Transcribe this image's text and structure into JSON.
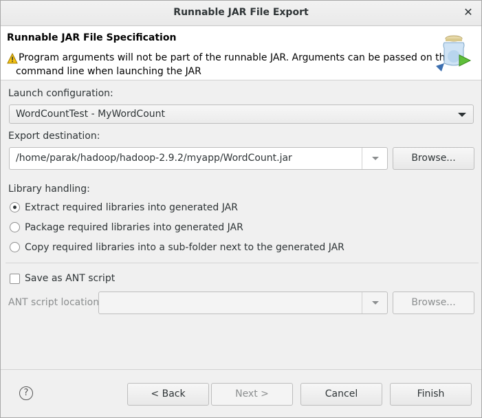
{
  "window": {
    "title": "Runnable JAR File Export",
    "close_glyph": "✕"
  },
  "header": {
    "title": "Runnable JAR File Specification",
    "warning_icon": "warning-triangle-icon",
    "message_line1": "Program arguments will not be part of the runnable JAR. Arguments can be passed on the",
    "message_line2": "command line when launching the JAR",
    "banner_icon": "jar-export-icon"
  },
  "launch": {
    "label": "Launch configuration:",
    "value": "WordCountTest - MyWordCount"
  },
  "export": {
    "label": "Export destination:",
    "value": "/home/parak/hadoop/hadoop-2.9.2/myapp/WordCount.jar",
    "browse_label": "Browse..."
  },
  "library": {
    "label": "Library handling:",
    "options": [
      {
        "label": "Extract required libraries into generated JAR",
        "selected": true
      },
      {
        "label": "Package required libraries into generated JAR",
        "selected": false
      },
      {
        "label": "Copy required libraries into a sub-folder next to the generated JAR",
        "selected": false
      }
    ]
  },
  "ant": {
    "save_label": "Save as ANT script",
    "checked": false,
    "location_label": "ANT script location:",
    "location_value": "",
    "browse_label": "Browse..."
  },
  "footer": {
    "help_glyph": "?",
    "back_label": "< Back",
    "next_label": "Next >",
    "cancel_label": "Cancel",
    "finish_label": "Finish"
  }
}
